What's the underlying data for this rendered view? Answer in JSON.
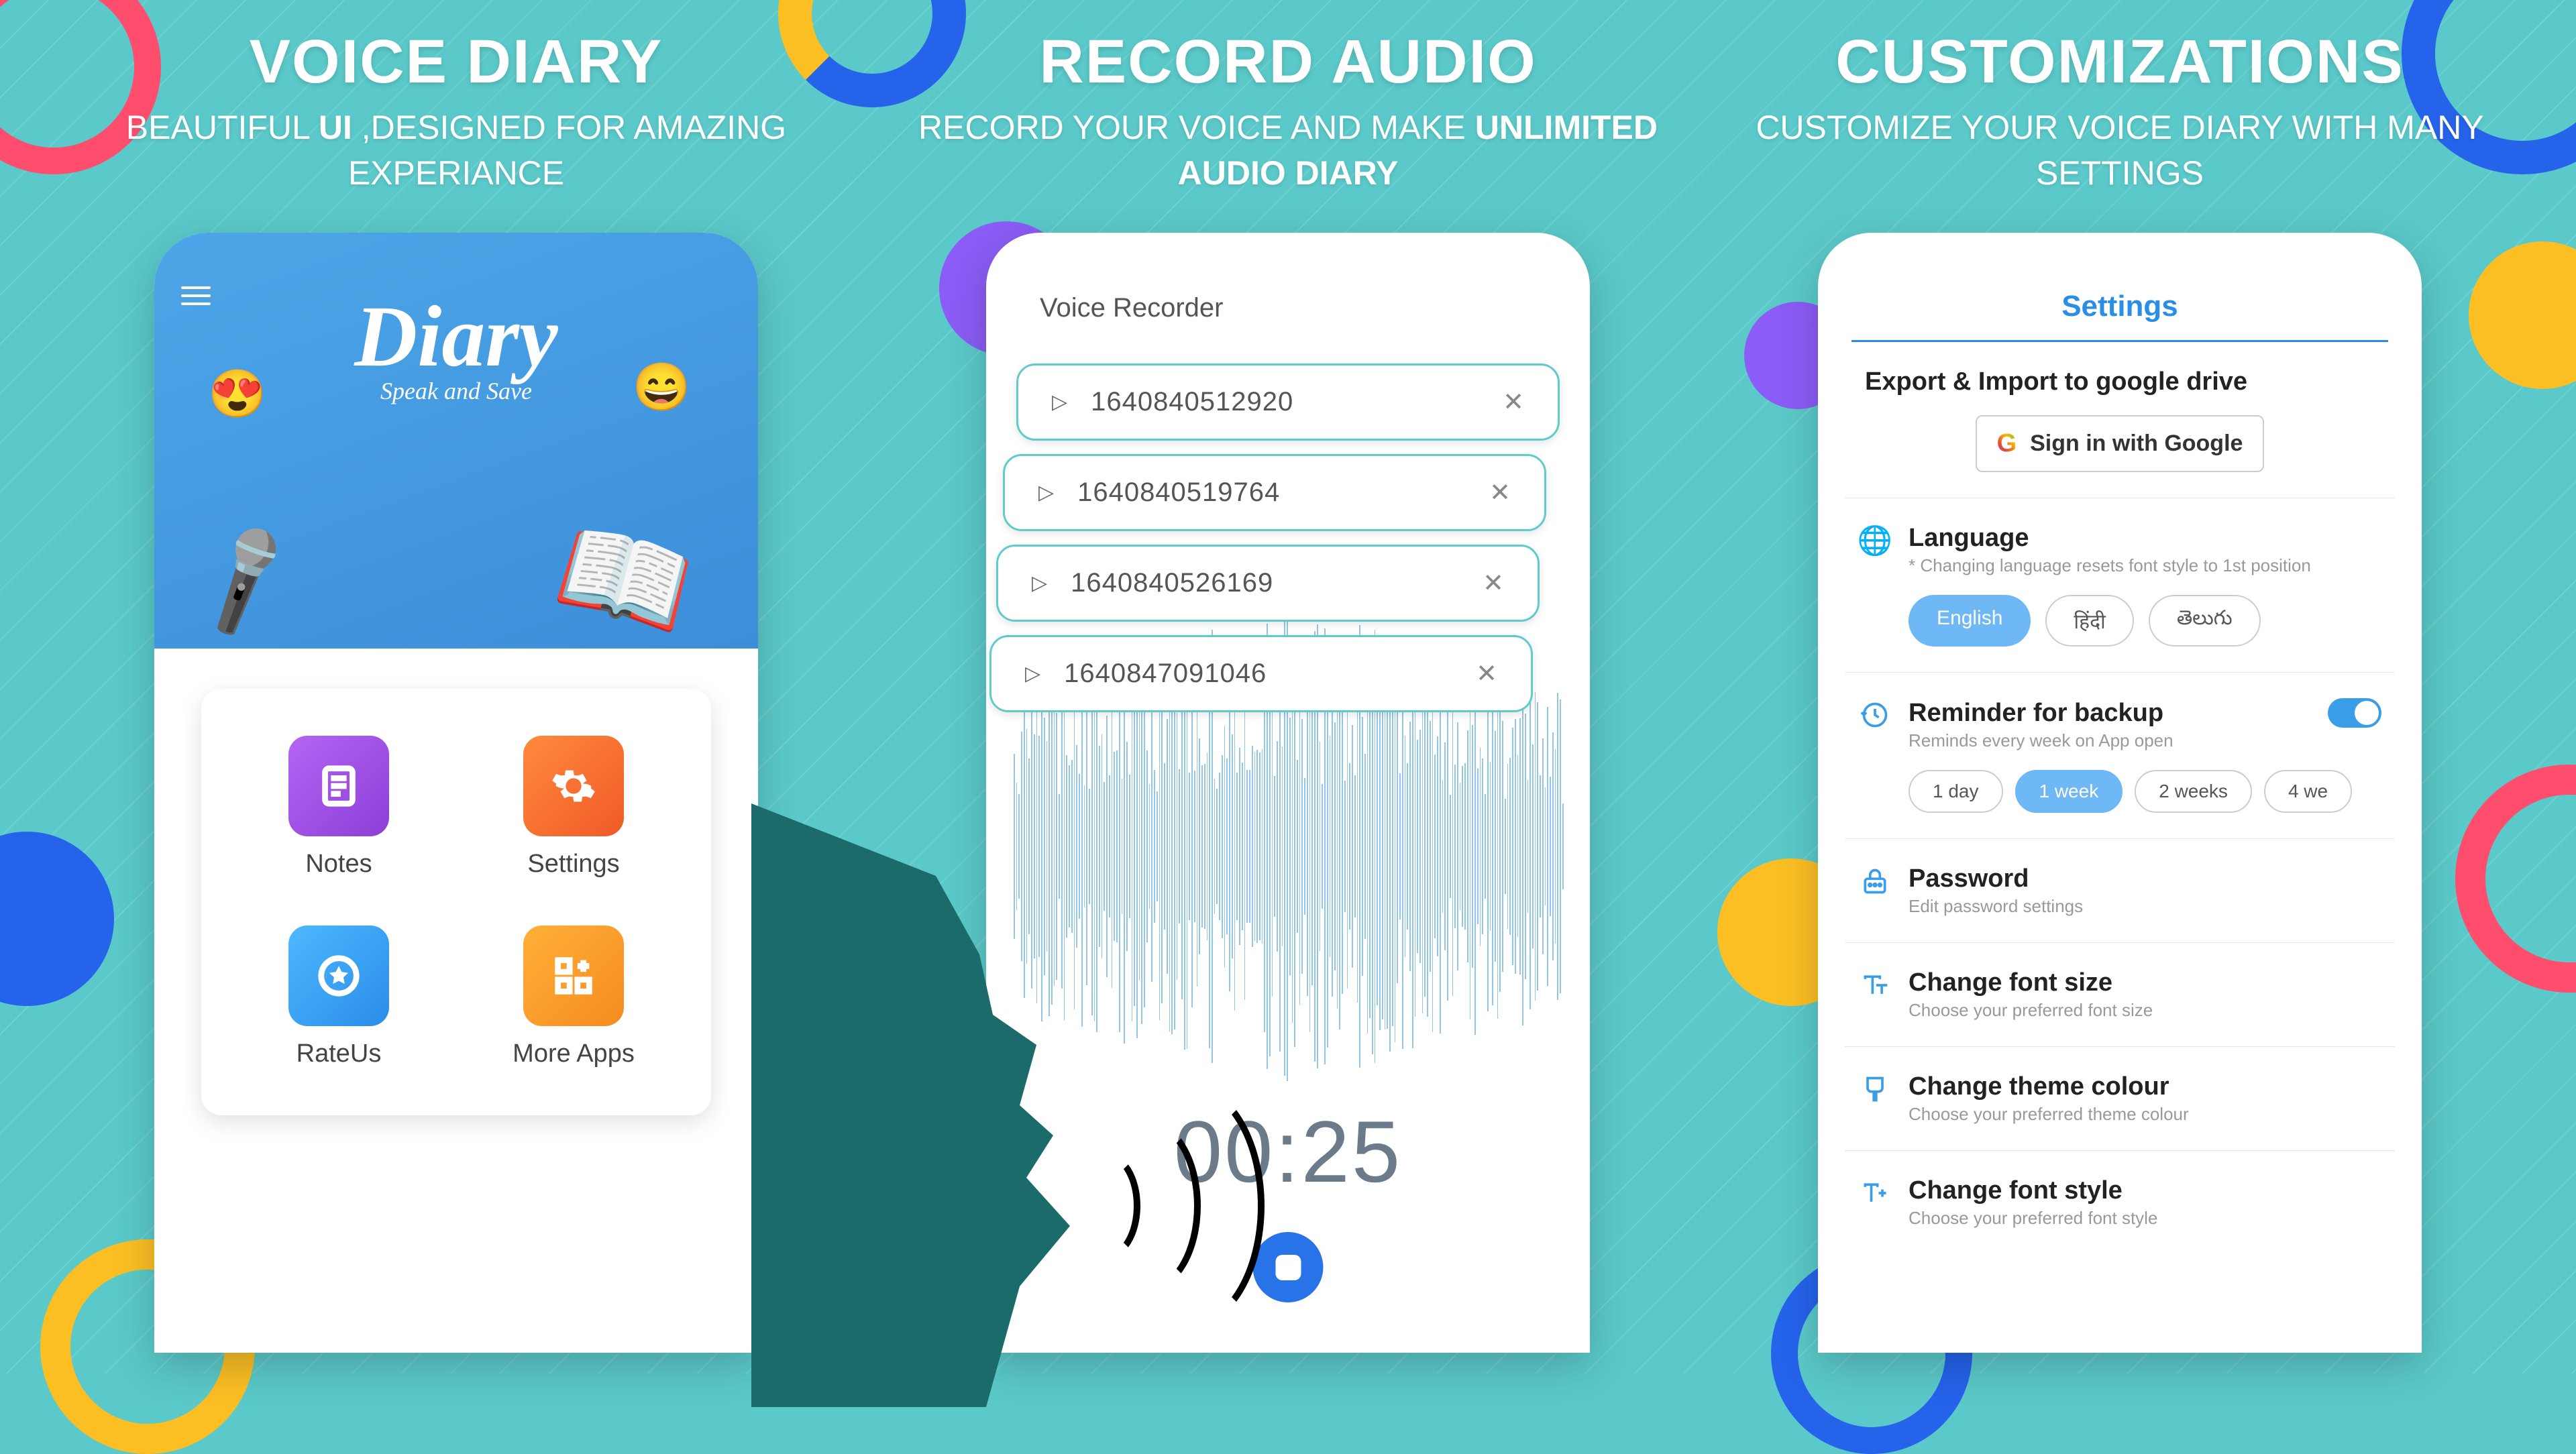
{
  "panels": [
    {
      "title": "VOICE DIARY",
      "sub_pre": "BEAUTIFUL ",
      "sub_bold1": "UI",
      "sub_mid": " ,DESIGNED FOR AMAZING EXPERIANCE"
    },
    {
      "title": "RECORD AUDIO",
      "sub_pre": "RECORD YOUR VOICE AND MAKE ",
      "sub_bold1": "UNLIMITED AUDIO DIARY",
      "sub_mid": ""
    },
    {
      "title": "CUSTOMIZATIONS",
      "sub_pre": "CUSTOMIZE YOUR VOICE DIARY WITH MANY SETTINGS",
      "sub_bold1": "",
      "sub_mid": ""
    }
  ],
  "phone1": {
    "app_title": "Diary",
    "app_subtitle": "Speak and Save",
    "menu": {
      "notes": "Notes",
      "settings": "Settings",
      "rateus": "RateUs",
      "moreapps": "More Apps"
    }
  },
  "phone2": {
    "screen_title": "Voice Recorder",
    "recordings": [
      "1640840512920",
      "1640840519764",
      "1640840526169",
      "1640847091046"
    ],
    "timer": "00:25"
  },
  "phone3": {
    "header": "Settings",
    "export_label": "Export & Import to google drive",
    "google_btn": "Sign in with Google",
    "language": {
      "title": "Language",
      "desc": "* Changing language resets font style to 1st position",
      "options": [
        "English",
        "हिंदी",
        "తెలుగు"
      ]
    },
    "reminder": {
      "title": "Reminder for backup",
      "desc": "Reminds every week on App open",
      "options": [
        "1 day",
        "1 week",
        "2 weeks",
        "4 we"
      ]
    },
    "password": {
      "title": "Password",
      "desc": "Edit password settings"
    },
    "fontsize": {
      "title": "Change font size",
      "desc": "Choose your preferred font size"
    },
    "theme": {
      "title": "Change theme colour",
      "desc": "Choose your preferred theme colour"
    },
    "fontstyle": {
      "title": "Change font style",
      "desc": "Choose your preferred font style"
    }
  }
}
